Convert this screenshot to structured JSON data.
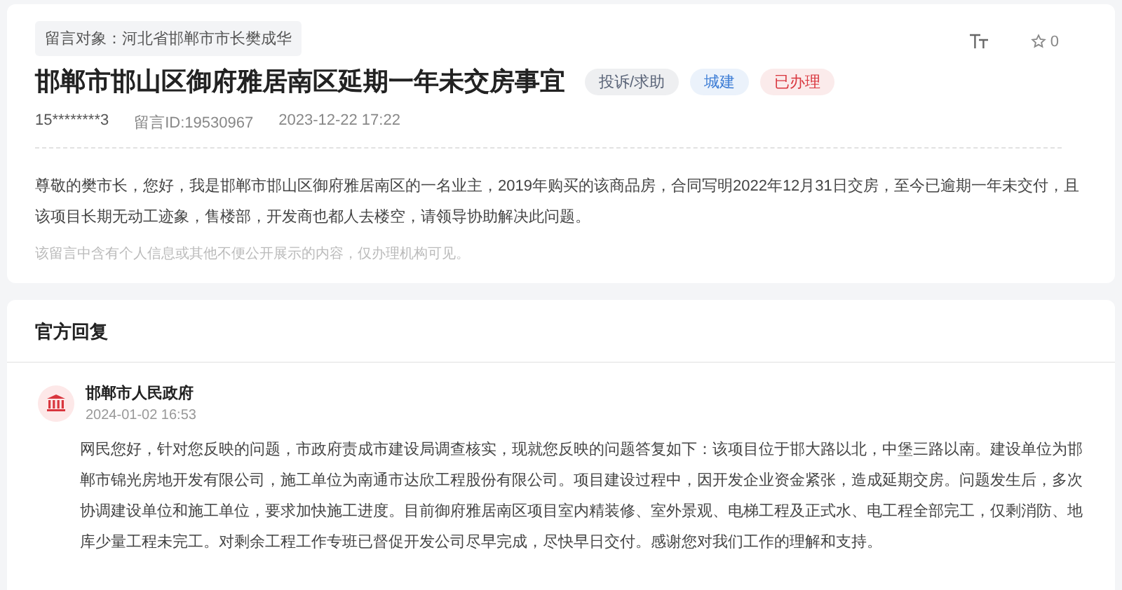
{
  "message": {
    "target": "留言对象：河北省邯郸市市长樊成华",
    "title": "邯郸市邯山区御府雅居南区延期一年未交房事宜",
    "tags": [
      {
        "label": "投诉/求助",
        "color": "#5a6478"
      },
      {
        "label": "城建",
        "color": "#3a7bd5"
      },
      {
        "label": "已办理",
        "color": "#d9363e"
      }
    ],
    "likes": "0",
    "author": "15********3",
    "message_id": "留言ID:19530967",
    "time": "2023-12-22 17:22",
    "body": "尊敬的樊市长，您好，我是邯郸市邯山区御府雅居南区的一名业主，2019年购买的该商品房，合同写明2022年12月31日交房，至今已逾期一年未交付，且该项目长期无动工迹象，售楼部，开发商也都人去楼空，请领导协助解决此问题。",
    "notice": "该留言中含有个人信息或其他不便公开展示的内容，仅办理机构可见。"
  },
  "reply": {
    "heading": "官方回复",
    "agency": "邯郸市人民政府",
    "time": "2024-01-02 16:53",
    "body": "网民您好，针对您反映的问题，市政府责成市建设局调查核实，现就您反映的问题答复如下：该项目位于邯大路以北，中堡三路以南。建设单位为邯郸市锦光房地开发有限公司，施工单位为南通市达欣工程股份有限公司。项目建设过程中，因开发企业资金紧张，造成延期交房。问题发生后，多次协调建设单位和施工单位，要求加快施工进度。目前御府雅居南区项目室内精装修、室外景观、电梯工程及正式水、电工程全部完工，仅剩消防、地库少量工程未完工。对剩余工程工作专班已督促开发公司尽早完成，尽快早日交付。感谢您对我们工作的理解和支持。"
  }
}
